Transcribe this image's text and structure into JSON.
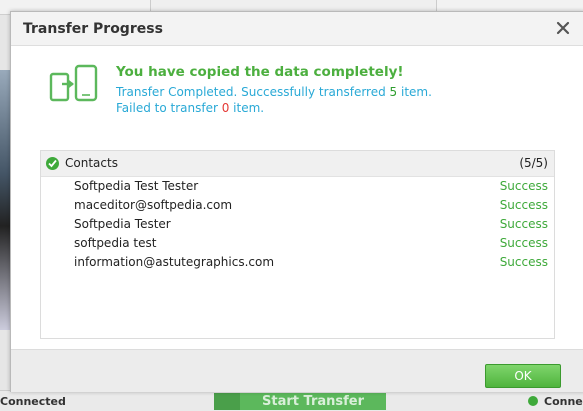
{
  "background": {
    "status_left": "Connected",
    "status_right": "Conne",
    "start_transfer_label": "Start Transfer"
  },
  "dialog": {
    "title": "Transfer Progress",
    "headline": "You have copied the data completely!",
    "line1_prefix": "Transfer Completed. Successfully transferred ",
    "success_count": "5",
    "line1_suffix": " item.",
    "line2_prefix": "Failed to transfer ",
    "failed_count": "0",
    "line2_suffix": " item.",
    "category": {
      "label": "Contacts",
      "count": "(5/5)"
    },
    "items": [
      {
        "name": "Softpedia Test Tester",
        "status": "Success"
      },
      {
        "name": "maceditor@softpedia.com",
        "status": "Success"
      },
      {
        "name": "Softpedia Tester",
        "status": "Success"
      },
      {
        "name": "softpedia test",
        "status": "Success"
      },
      {
        "name": "information@astutegraphics.com",
        "status": "Success"
      }
    ],
    "ok_label": "OK"
  },
  "colors": {
    "accent_green": "#4caf3f",
    "info_blue": "#29a9d6",
    "failed_red": "#e53935"
  },
  "icons": [
    "close-icon",
    "transfer-phones-icon",
    "check-circle-icon"
  ]
}
